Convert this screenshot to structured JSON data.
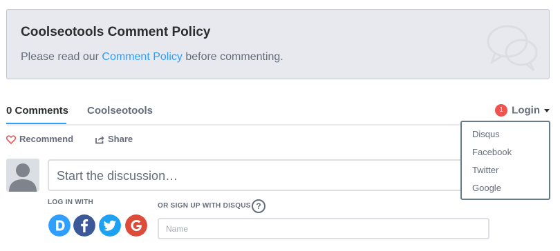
{
  "policy": {
    "title": "Coolseotools Comment Policy",
    "text_before": "Please read our ",
    "link_text": "Comment Policy",
    "text_after": " before commenting."
  },
  "nav": {
    "tabs": [
      {
        "label": "0 Comments",
        "active": true
      },
      {
        "label": "Coolseotools",
        "active": false
      }
    ],
    "login": {
      "badge_count": "1",
      "label": "Login"
    }
  },
  "login_menu": {
    "items": [
      "Disqus",
      "Facebook",
      "Twitter",
      "Google"
    ]
  },
  "actions": {
    "recommend_label": "Recommend",
    "share_label": "Share"
  },
  "compose": {
    "placeholder": "Start the discussion…"
  },
  "auth": {
    "login_with_label": "LOG IN WITH",
    "signup_label": "OR SIGN UP WITH DISQUS",
    "help_symbol": "?",
    "name_placeholder": "Name",
    "providers": [
      {
        "name": "disqus-icon",
        "glyph": "D",
        "color": "#2e9fff"
      },
      {
        "name": "facebook-icon",
        "glyph": "f",
        "color": "#3b5998"
      },
      {
        "name": "twitter-icon",
        "glyph": "twitter",
        "color": "#1da1f2"
      },
      {
        "name": "google-icon",
        "glyph": "G",
        "color": "#dd4b39"
      }
    ]
  },
  "colors": {
    "accent": "#2e9fff",
    "badge": "#ef5350",
    "text_primary": "#2a2e2e",
    "text_secondary": "#656c7a",
    "panel_bg": "#e7e9ee"
  }
}
